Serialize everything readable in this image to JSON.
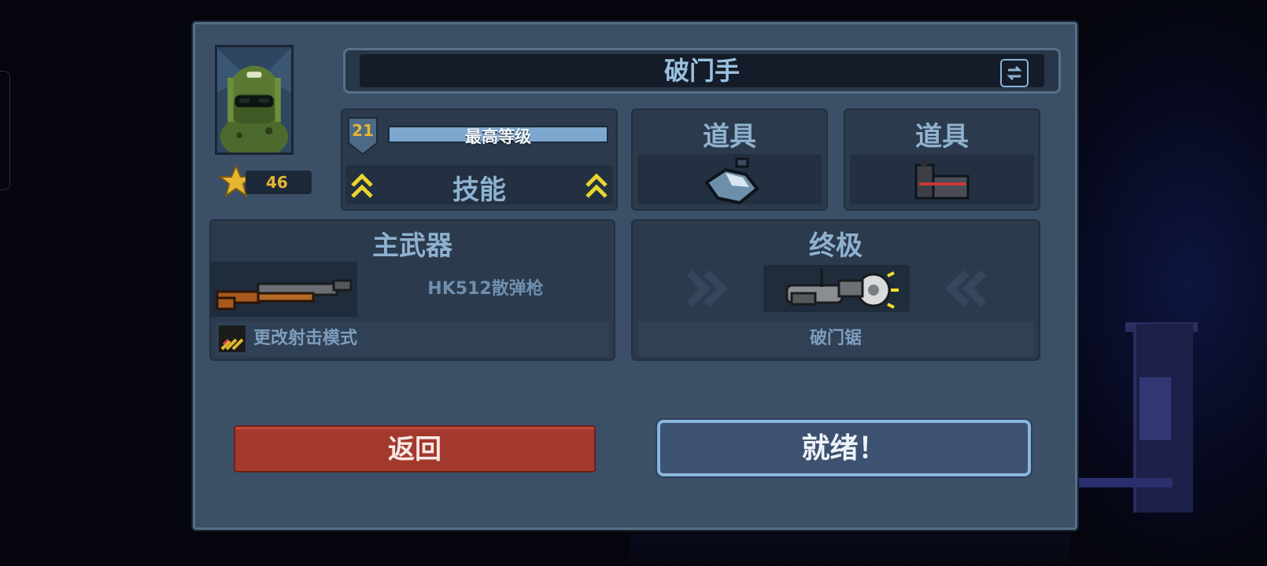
{
  "character": {
    "name": "破门手",
    "stars": "46",
    "level": "21",
    "level_status": "最高等级",
    "level_progress": 1.0,
    "skills_label": "技能"
  },
  "items": [
    {
      "label": "道具",
      "icon": "grenade-icon"
    },
    {
      "label": "道具",
      "icon": "breaching-charge-icon"
    }
  ],
  "weapon": {
    "section_label": "主武器",
    "name": "HK512散弹枪",
    "mode_label": "更改射击模式",
    "icon": "shotgun-icon"
  },
  "ultimate": {
    "section_label": "终极",
    "name": "破门锯",
    "icon": "saw-icon"
  },
  "buttons": {
    "back": "返回",
    "ready": "就绪！"
  },
  "colors": {
    "panel": "#3b4f66",
    "back_button": "#a3392d",
    "ready_border": "#88b6de",
    "star": "#e7b534"
  }
}
